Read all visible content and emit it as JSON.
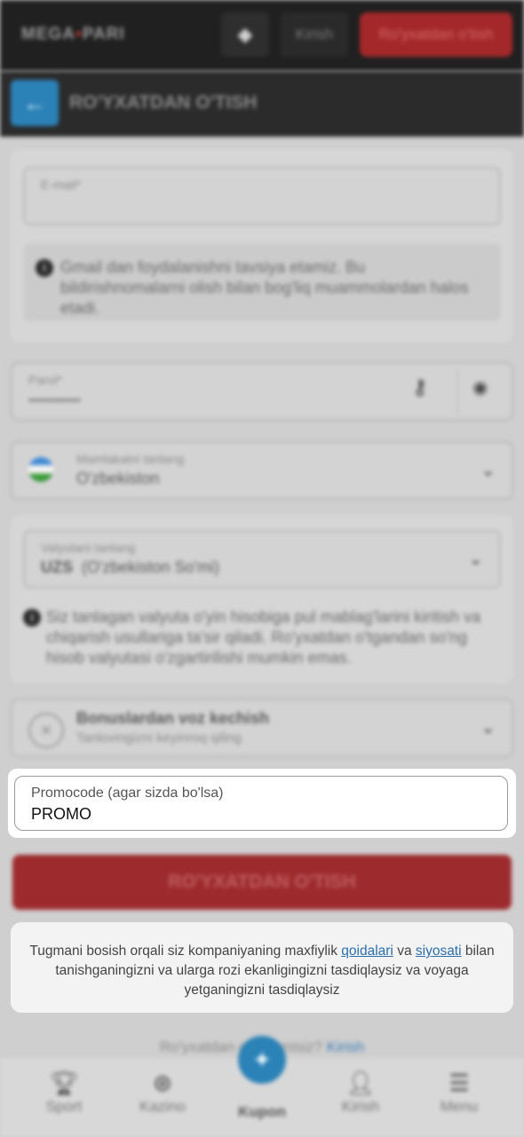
{
  "header": {
    "logo_left": "MEGA",
    "logo_right": "PARI",
    "login": "Kirish",
    "register": "Ro'yxatdan o'tish"
  },
  "subheader": {
    "title": "RO'YXATDAN O'TISH"
  },
  "form": {
    "email_label": "E-mail*",
    "email_hint": "Gmail dan foydalanishni tavsiya etamiz. Bu bildirishnomalarni olish bilan bog'liq muammolardan halos etadi.",
    "password_label": "Parol*",
    "password_value": "••••••••••••••",
    "country_label": "Mamlakatni tanlang",
    "country_value": "O'zbekiston",
    "currency_label": "Valyutani tanlang",
    "currency_code": "UZS",
    "currency_name": "(O'zbekiston So'mi)",
    "currency_hint": "Siz tanlagan valyuta o'yin hisobiga pul mablag'larini kiritish va chiqarish usullariga ta'sir qiladi. Ro'yxatdan o'tgandan so'ng hisob valyutasi o'zgartirilishi mumkin emas.",
    "bonus_title": "Bonuslardan voz kechish",
    "bonus_sub": "Tanlovingizni keyinroq qiling",
    "promo_label": "Promocode (agar sizda bo'lsa)",
    "promo_value": "PROMO",
    "submit": "RO'YXATDAN O'TISH"
  },
  "terms": {
    "t1": "Tugmani bosish orqali siz kompaniyaning maxfiylik ",
    "link1": "qoidalari",
    "t2": " va ",
    "link2": "siyosati",
    "t3": " bilan tanishganingizni va ularga rozi ekanligingizni tasdiqlaysiz va voyaga yetganingizni tasdiqlaysiz"
  },
  "already": {
    "text": "Ro'yxatdan o'tganmisiz? ",
    "link": "Kirish"
  },
  "nav": {
    "sport": "Sport",
    "kazino": "Kazino",
    "kupon": "Kupon",
    "kirish": "Kirish",
    "menu": "Menu"
  }
}
